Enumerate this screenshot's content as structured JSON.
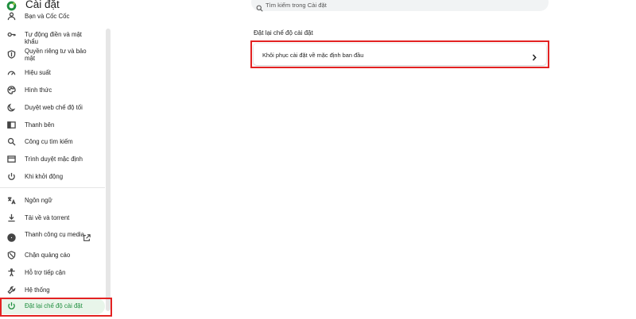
{
  "app": {
    "title": "Cài đặt"
  },
  "search": {
    "placeholder": "Tìm kiếm trong Cài đặt"
  },
  "sidebar": {
    "items": [
      {
        "label": "Bạn và Cốc Cốc",
        "icon": "person-icon"
      },
      {
        "label": "Tự động điền và mật khẩu",
        "icon": "key-icon"
      },
      {
        "label": "Quyền riêng tư và bảo mật",
        "icon": "shield-icon"
      },
      {
        "label": "Hiệu suất",
        "icon": "speedometer-icon"
      },
      {
        "label": "Hình thức",
        "icon": "palette-icon"
      },
      {
        "label": "Duyệt web chế độ tối",
        "icon": "moon-icon"
      },
      {
        "label": "Thanh bên",
        "icon": "sidebar-panel-icon"
      },
      {
        "label": "Công cụ tìm kiếm",
        "icon": "search-icon"
      },
      {
        "label": "Trình duyệt mặc định",
        "icon": "browser-window-icon"
      },
      {
        "label": "Khi khởi động",
        "icon": "power-icon"
      },
      {
        "label": "Ngôn ngữ",
        "icon": "translate-icon"
      },
      {
        "label": "Tải về và torrent",
        "icon": "download-icon"
      },
      {
        "label": "Thanh công cụ media",
        "icon": "media-disc-icon"
      },
      {
        "label": "Chặn quảng cáo",
        "icon": "adblock-shield-icon"
      },
      {
        "label": "Hỗ trợ tiếp cận",
        "icon": "accessibility-icon"
      },
      {
        "label": "Hệ thống",
        "icon": "wrench-icon"
      },
      {
        "label": "Đặt lại chế độ cài đặt",
        "icon": "reset-icon"
      }
    ]
  },
  "main": {
    "section_title": "Đặt lại chế độ cài đặt",
    "reset_card_label": "Khôi phục cài đặt về mặc định ban đầu"
  },
  "colors": {
    "accent": "#1e8e3e",
    "highlight_border": "#e32222"
  }
}
